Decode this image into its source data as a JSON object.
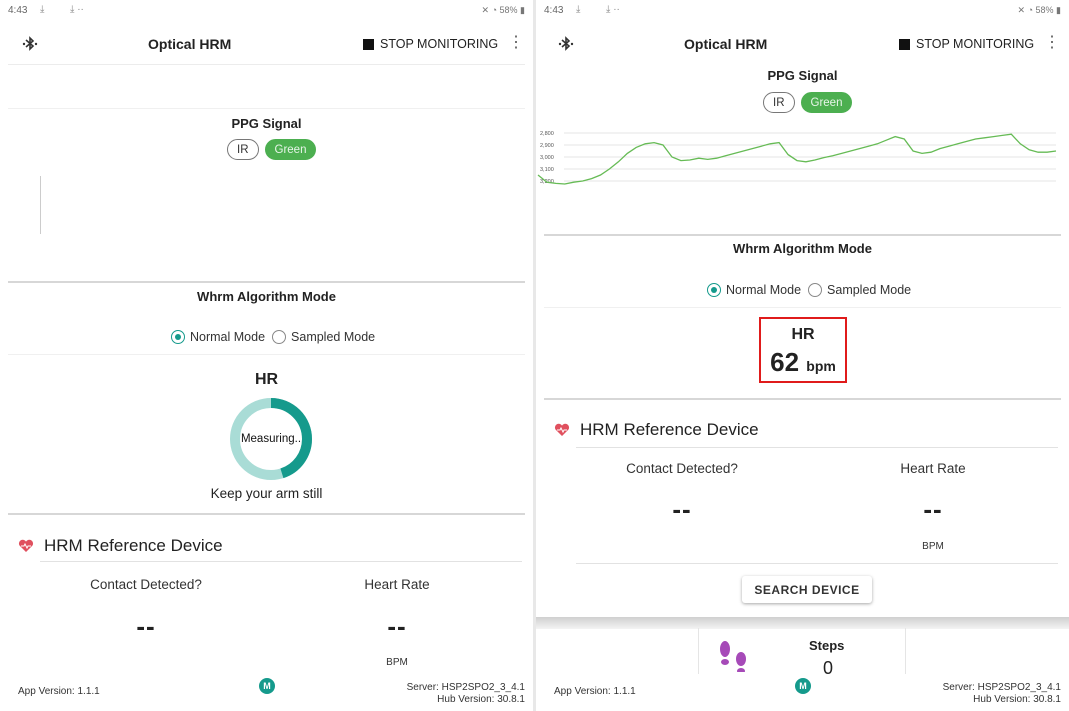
{
  "statusbar": {
    "time": "4:43",
    "right": "58%"
  },
  "toolbar": {
    "title": "Optical HRM",
    "stop_label": "STOP MONITORING"
  },
  "ppg": {
    "title": "PPG Signal",
    "chip_ir": "IR",
    "chip_green": "Green",
    "y_ticks": [
      "3,200",
      "3,100",
      "3,000",
      "2,900",
      "2,800"
    ]
  },
  "algo": {
    "title": "Whrm Algorithm Mode",
    "normal": "Normal Mode",
    "sampled": "Sampled Mode",
    "selected": "Normal Mode"
  },
  "hr": {
    "label": "HR",
    "measuring": "Measuring..",
    "keep_still": "Keep your arm still",
    "value": "62",
    "unit": "bpm",
    "progress": 0.45
  },
  "reference": {
    "title": "HRM Reference Device",
    "contact_label": "Contact Detected?",
    "heart_rate_label": "Heart Rate",
    "contact_value": "--",
    "heart_rate_value": "--",
    "bpm": "BPM",
    "search_button": "SEARCH DEVICE"
  },
  "steps": {
    "label": "Steps",
    "value": "0"
  },
  "footer": {
    "app_version": "App Version: 1.1.1",
    "server": "Server: HSP2SPO2_3_4.1",
    "hub": "Hub Version: 30.8.1",
    "logo": "M"
  },
  "colors": {
    "accent": "#159a8c",
    "green_chip": "#4caf50",
    "heart": "#e0505e",
    "highlight": "#e01b1b",
    "ring_light": "#a9dcd6"
  },
  "chart_data": {
    "type": "line",
    "title": "",
    "xlabel": "",
    "ylabel": "",
    "ylim": [
      2750,
      3250
    ],
    "y_ticks": [
      2800,
      2900,
      3000,
      3100,
      3200
    ],
    "series": [
      {
        "values": [
          2850,
          2790,
          2780,
          2775,
          2790,
          2800,
          2820,
          2850,
          2900,
          2960,
          3030,
          3080,
          3110,
          3120,
          3100,
          3000,
          2970,
          2975,
          2990,
          2980,
          2990,
          3010,
          3030,
          3050,
          3070,
          3090,
          3110,
          3120,
          3020,
          2970,
          2960,
          2975,
          2995,
          3010,
          3030,
          3050,
          3070,
          3090,
          3110,
          3140,
          3170,
          3150,
          3050,
          3030,
          3040,
          3070,
          3090,
          3110,
          3130,
          3150,
          3160,
          3170,
          3180,
          3190,
          3110,
          3060,
          3040,
          3040,
          3050
        ]
      }
    ]
  }
}
